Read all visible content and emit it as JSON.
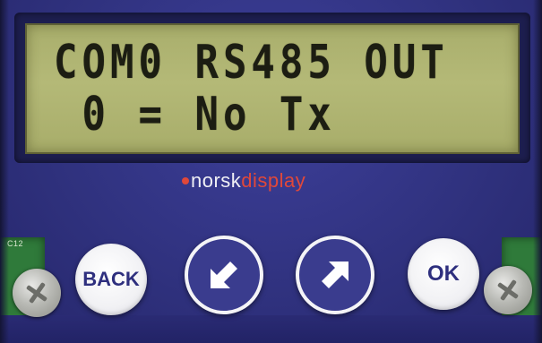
{
  "lcd": {
    "line1": "COM0 RS485 OUT",
    "line2": " 0 = No Tx"
  },
  "brand": {
    "dot": "•",
    "part1": "norsk",
    "part2": "display",
    "accent_color": "#e0483a"
  },
  "buttons": {
    "back_label": "BACK",
    "ok_label": "OK",
    "down_left_icon": "arrow-down-left-icon",
    "up_right_icon": "arrow-up-right-icon"
  },
  "pcb": {
    "label": "C12"
  },
  "colors": {
    "panel": "#30327f",
    "lcd_background": "#b4b977",
    "lcd_text": "#1c1d12",
    "button_face": "#f1f1f4",
    "button_text": "#2e2f7e"
  }
}
